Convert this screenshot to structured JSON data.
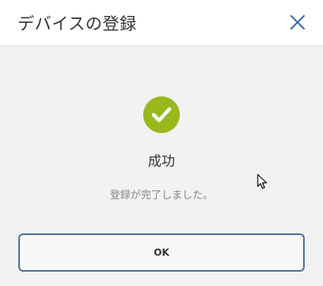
{
  "dialog": {
    "title": "デバイスの登録",
    "close_icon": "close-icon",
    "status": {
      "icon": "check-circle-icon",
      "icon_color": "#9ab81c",
      "title": "成功",
      "message": "登録が完了しました。"
    },
    "ok_label": "OK"
  },
  "colors": {
    "accent": "#4a6f99",
    "success": "#9ab81c"
  }
}
